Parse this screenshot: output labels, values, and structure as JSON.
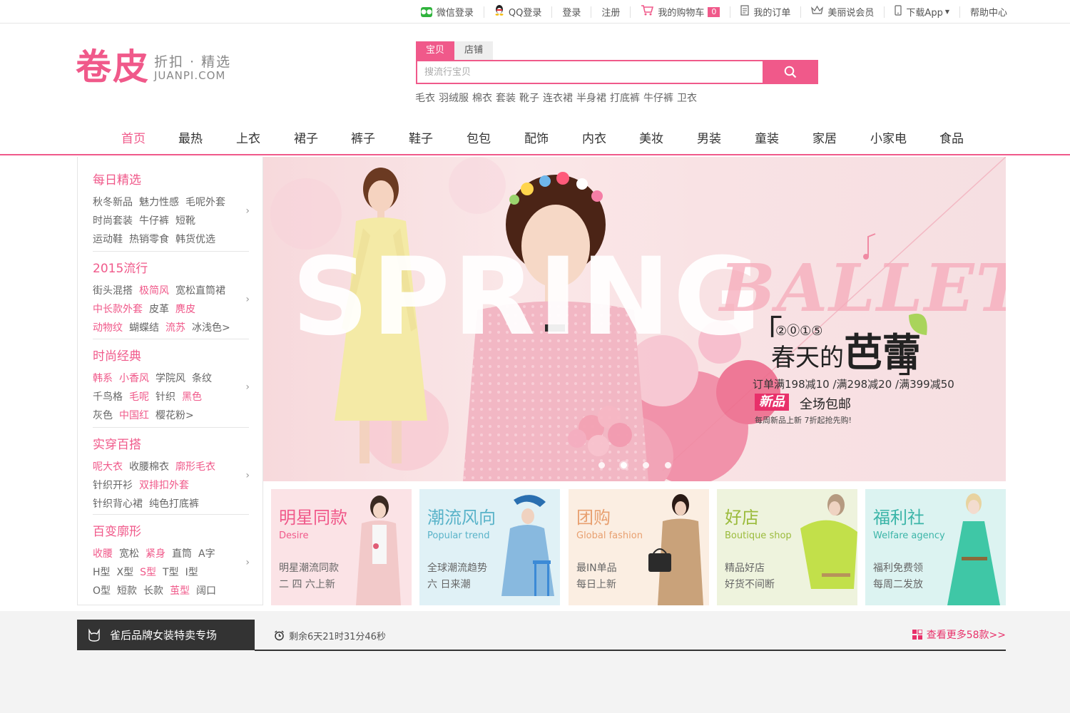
{
  "topbar": {
    "wechat_login": "微信登录",
    "qq_login": "QQ登录",
    "login": "登录",
    "register": "注册",
    "cart": "我的购物车",
    "cart_count": "0",
    "orders": "我的订单",
    "vip": "美丽说会员",
    "download_app": "下载App",
    "help": "帮助中心"
  },
  "logo": {
    "main": "卷皮",
    "tagline": "折扣 · 精选",
    "domain": "JUANPI.COM"
  },
  "search": {
    "tabs": [
      "宝贝",
      "店铺"
    ],
    "placeholder": "搜流行宝贝",
    "hot_words": [
      "毛衣",
      "羽绒服",
      "棉衣",
      "套装",
      "靴子",
      "连衣裙",
      "半身裙",
      "打底裤",
      "牛仔裤",
      "卫衣"
    ]
  },
  "nav": [
    "首页",
    "最热",
    "上衣",
    "裙子",
    "裤子",
    "鞋子",
    "包包",
    "配饰",
    "内衣",
    "美妆",
    "男装",
    "童装",
    "家居",
    "小家电",
    "食品"
  ],
  "sidebar": [
    {
      "title": "每日精选",
      "lines": [
        [
          {
            "t": "秋冬新品",
            "p": false
          },
          {
            "t": "魅力性感",
            "p": false
          },
          {
            "t": "毛呢外套",
            "p": false
          }
        ],
        [
          {
            "t": "时尚套装",
            "p": false
          },
          {
            "t": "牛仔裤",
            "p": false
          },
          {
            "t": "短靴",
            "p": false
          }
        ],
        [
          {
            "t": "运动鞋",
            "p": false
          },
          {
            "t": "热销零食",
            "p": false
          },
          {
            "t": "韩货优选",
            "p": false
          }
        ]
      ]
    },
    {
      "title": "2015流行",
      "lines": [
        [
          {
            "t": "街头混搭",
            "p": false
          },
          {
            "t": "极简风",
            "p": true
          },
          {
            "t": "宽松直筒裙",
            "p": false
          }
        ],
        [
          {
            "t": "中长款外套",
            "p": true
          },
          {
            "t": "皮革",
            "p": false
          },
          {
            "t": "麂皮",
            "p": true
          }
        ],
        [
          {
            "t": "动物纹",
            "p": true
          },
          {
            "t": "蝴蝶结",
            "p": false
          },
          {
            "t": "流苏",
            "p": true
          },
          {
            "t": "冰浅色>",
            "p": false
          }
        ]
      ]
    },
    {
      "title": "时尚经典",
      "lines": [
        [
          {
            "t": "韩系",
            "p": true
          },
          {
            "t": "小香风",
            "p": true
          },
          {
            "t": "学院风",
            "p": false
          },
          {
            "t": "条纹",
            "p": false
          }
        ],
        [
          {
            "t": "千鸟格",
            "p": false
          },
          {
            "t": "毛呢",
            "p": true
          },
          {
            "t": "针织",
            "p": false
          },
          {
            "t": "黑色",
            "p": true
          }
        ],
        [
          {
            "t": "灰色",
            "p": false
          },
          {
            "t": "中国红",
            "p": true
          },
          {
            "t": "樱花粉>",
            "p": false
          }
        ]
      ]
    },
    {
      "title": "实穿百搭",
      "lines": [
        [
          {
            "t": "呢大衣",
            "p": true
          },
          {
            "t": "收腰棉衣",
            "p": false
          },
          {
            "t": "廓形毛衣",
            "p": true
          }
        ],
        [
          {
            "t": "针织开衫",
            "p": false
          },
          {
            "t": "双排扣外套",
            "p": true
          }
        ],
        [
          {
            "t": "针织背心裙",
            "p": false
          },
          {
            "t": "纯色打底裤",
            "p": false
          }
        ]
      ]
    },
    {
      "title": "百变廓形",
      "lines": [
        [
          {
            "t": "收腰",
            "p": true
          },
          {
            "t": "宽松",
            "p": false
          },
          {
            "t": "紧身",
            "p": true
          },
          {
            "t": "直筒",
            "p": false
          },
          {
            "t": "A字",
            "p": false
          }
        ],
        [
          {
            "t": "H型",
            "p": false
          },
          {
            "t": "X型",
            "p": false
          },
          {
            "t": "S型",
            "p": true
          },
          {
            "t": "T型",
            "p": false
          },
          {
            "t": "I型",
            "p": false
          }
        ],
        [
          {
            "t": "O型",
            "p": false
          },
          {
            "t": "短款",
            "p": false
          },
          {
            "t": "长款",
            "p": false
          },
          {
            "t": "茧型",
            "p": true
          },
          {
            "t": "阔口",
            "p": false
          }
        ]
      ]
    }
  ],
  "banner": {
    "bg_word": "SPRING",
    "script_word": "BALLET",
    "year": "②⓪①⑤",
    "title_small": "春天的",
    "title_big": "芭蕾",
    "promo": "订单满198减10 /满298减20 /满399减50",
    "new_badge": "新品",
    "free_ship": "全场包邮",
    "weekly": "每周新品上新 7折起抢先购!",
    "slides": 4,
    "active_slide": 2
  },
  "tiles": [
    {
      "title": "明星同款",
      "en": "Desire",
      "desc1": "明星潮流同款",
      "desc2": "二 四 六上新",
      "color": "#f0598a",
      "bg": "#fbe3e6"
    },
    {
      "title": "潮流风向",
      "en": "Popular trend",
      "desc1": "全球潮流趋势",
      "desc2": "六 日来潮",
      "color": "#59b3c9",
      "bg": "#e0f1f6"
    },
    {
      "title": "团购",
      "en": "Global fashion",
      "desc1": "最IN单品",
      "desc2": "每日上新",
      "color": "#e8a070",
      "bg": "#fbeee2"
    },
    {
      "title": "好店",
      "en": "Boutique shop",
      "desc1": "精品好店",
      "desc2": "好货不间断",
      "color": "#9bbb3c",
      "bg": "#eef3dd"
    },
    {
      "title": "福利社",
      "en": "Welfare agency",
      "desc1": "福利免费领",
      "desc2": "每周二发放",
      "color": "#3bb5a8",
      "bg": "#dcf3f1"
    }
  ],
  "bottom": {
    "tab_label": "雀后品牌女装特卖专场",
    "countdown": "剩余6天21时31分46秒",
    "more_link": "查看更多58款>>"
  },
  "colors": {
    "brand": "#f0598a",
    "dark": "#333333"
  }
}
